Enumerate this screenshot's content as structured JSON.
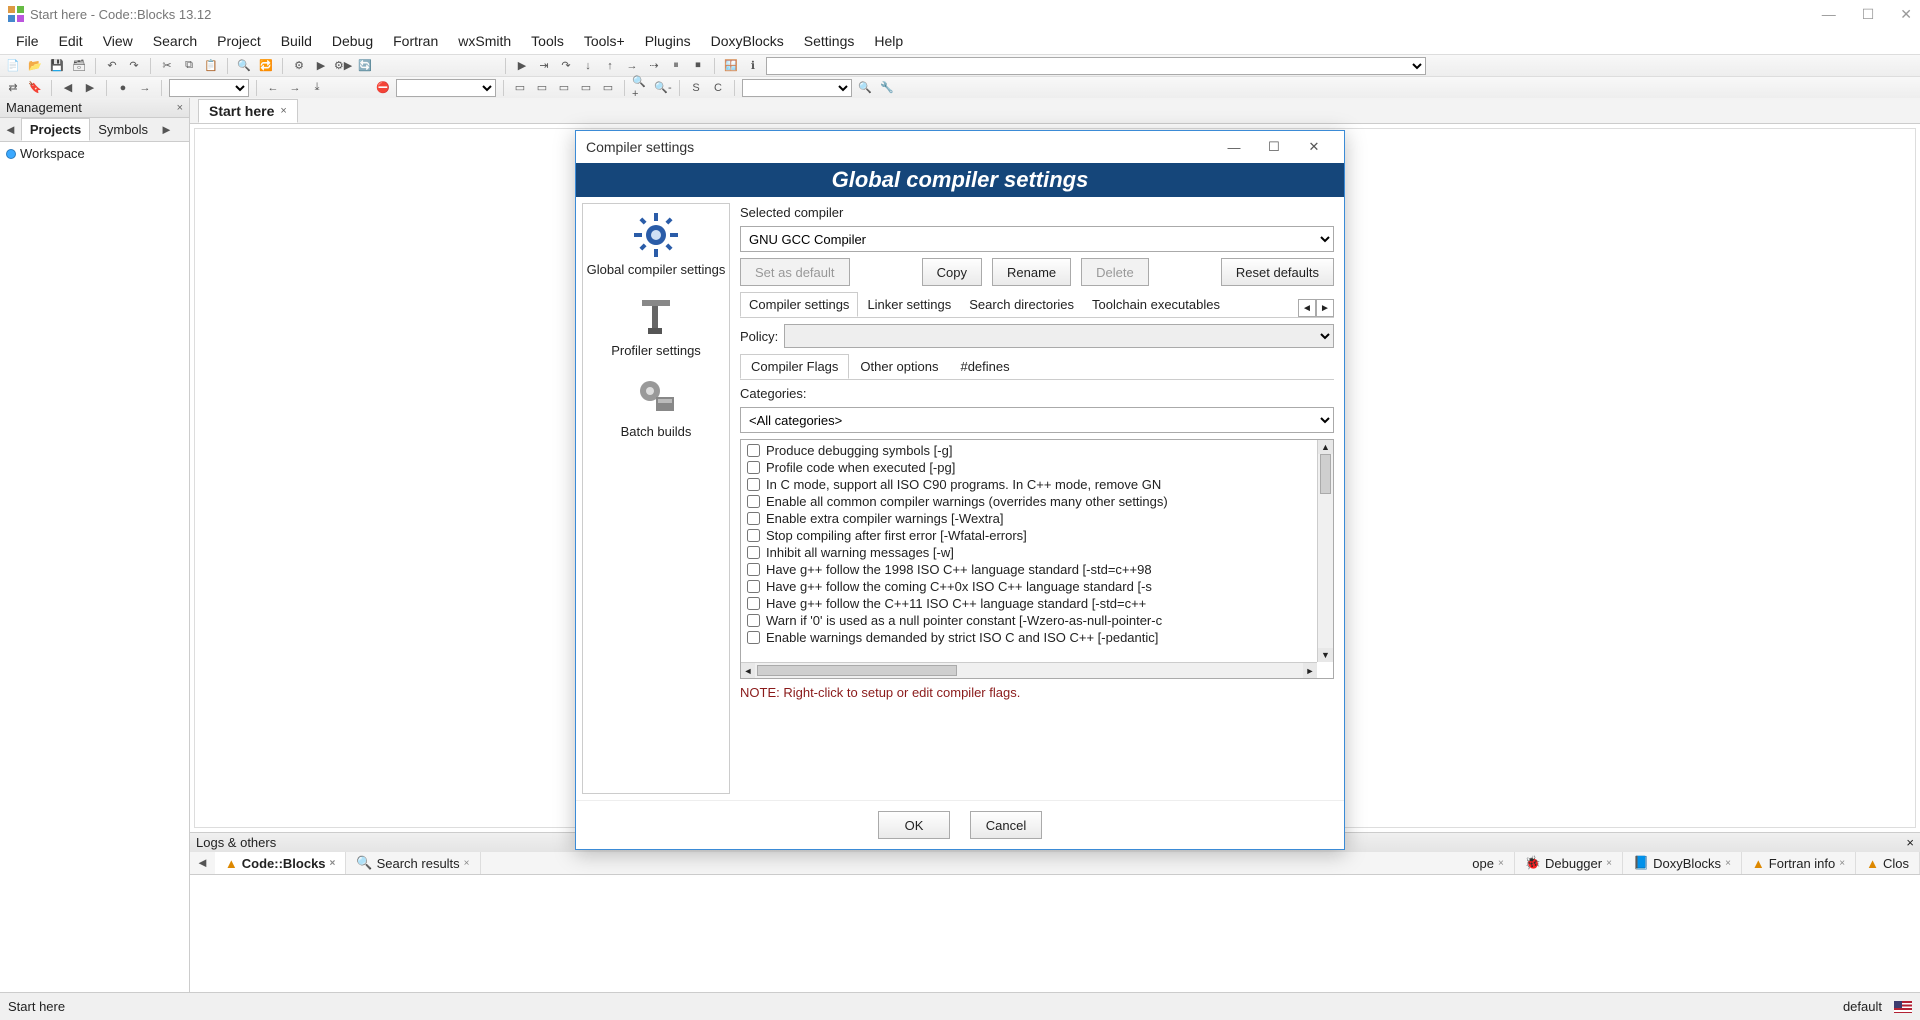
{
  "window": {
    "title": "Start here - Code::Blocks 13.12"
  },
  "menu": [
    "File",
    "Edit",
    "View",
    "Search",
    "Project",
    "Build",
    "Debug",
    "Fortran",
    "wxSmith",
    "Tools",
    "Tools+",
    "Plugins",
    "DoxyBlocks",
    "Settings",
    "Help"
  ],
  "management": {
    "title": "Management",
    "tabs": {
      "projects": "Projects",
      "symbols": "Symbols"
    },
    "workspace": "Workspace"
  },
  "editor": {
    "tab": "Start here"
  },
  "logs": {
    "title": "Logs & others",
    "tabs": [
      "Code::Blocks",
      "Search results",
      "",
      "",
      "",
      "ope",
      "Debugger",
      "DoxyBlocks",
      "Fortran info",
      "Clos"
    ]
  },
  "status": {
    "left": "Start here",
    "right": "default"
  },
  "dialog": {
    "title": "Compiler settings",
    "header": "Global compiler settings",
    "left": {
      "global": "Global compiler settings",
      "profiler": "Profiler settings",
      "batch": "Batch builds"
    },
    "selected_label": "Selected compiler",
    "selected_value": "GNU GCC Compiler",
    "buttons": {
      "set_default": "Set as default",
      "copy": "Copy",
      "rename": "Rename",
      "delete": "Delete",
      "reset": "Reset defaults"
    },
    "tabs": [
      "Compiler settings",
      "Linker settings",
      "Search directories",
      "Toolchain executables"
    ],
    "policy_label": "Policy:",
    "subtabs": [
      "Compiler Flags",
      "Other options",
      "#defines"
    ],
    "categories_label": "Categories:",
    "categories_value": "<All categories>",
    "flags": [
      "Produce debugging symbols  [-g]",
      "Profile code when executed  [-pg]",
      "In C mode, support all ISO C90 programs. In C++ mode, remove GN",
      "Enable all common compiler warnings (overrides many other settings)",
      "Enable extra compiler warnings  [-Wextra]",
      "Stop compiling after first error  [-Wfatal-errors]",
      "Inhibit all warning messages  [-w]",
      "Have g++ follow the 1998 ISO C++ language standard  [-std=c++98",
      "Have g++ follow the coming C++0x ISO C++ language standard  [-s",
      "Have g++ follow the C++11 ISO C++ language standard  [-std=c++",
      "Warn if '0' is used as a null pointer constant  [-Wzero-as-null-pointer-c",
      "Enable warnings demanded by strict ISO C and ISO C++  [-pedantic]"
    ],
    "note": "NOTE: Right-click to setup or edit compiler flags.",
    "ok": "OK",
    "cancel": "Cancel"
  }
}
